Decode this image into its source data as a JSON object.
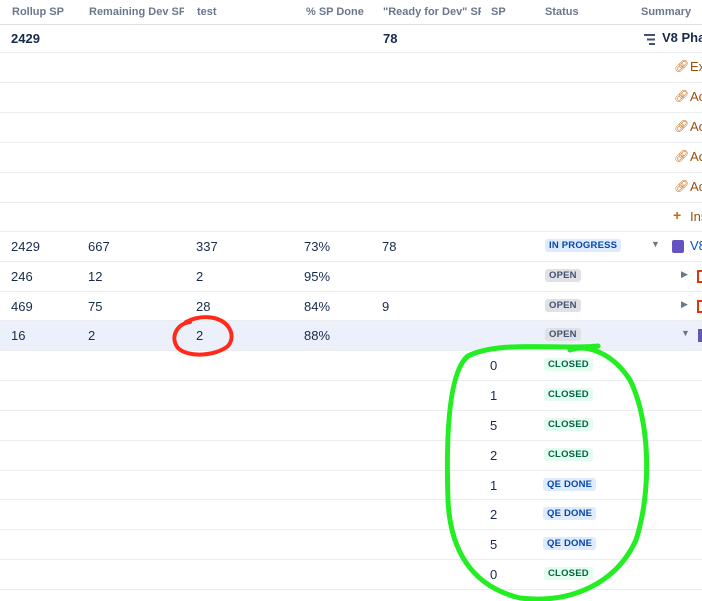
{
  "columns": {
    "rollup_sp": "Rollup SP",
    "remaining_dev_sp": "Remaining Dev SP",
    "test": "test",
    "pct_sp_done": "% SP Done",
    "ready_for_dev": "\"Ready for Dev\" SP",
    "sp": "SP",
    "status": "Status",
    "summary": "Summary"
  },
  "top_row": {
    "rollup_sp": "2429",
    "ready_for_dev": "78",
    "summary": "V8 Pha"
  },
  "link_rows": [
    {
      "label": "Ex"
    },
    {
      "label": "Ac"
    },
    {
      "label": "Ac"
    },
    {
      "label": "Ac"
    },
    {
      "label": "Ac"
    }
  ],
  "insert_row": {
    "label": "Ins"
  },
  "main_rows": [
    {
      "rollup": "2429",
      "remaining": "667",
      "test": "337",
      "pct": "73%",
      "ready": "78",
      "status": "IN PROGRESS",
      "status_type": "inprogress",
      "summary": "V8"
    },
    {
      "rollup": "246",
      "remaining": "12",
      "test": "2",
      "pct": "95%",
      "ready": "",
      "status": "OPEN",
      "status_type": "open",
      "summary": ""
    },
    {
      "rollup": "469",
      "remaining": "75",
      "test": "28",
      "pct": "84%",
      "ready": "9",
      "status": "OPEN",
      "status_type": "open",
      "summary": ""
    },
    {
      "rollup": "16",
      "remaining": "2",
      "test": "2",
      "pct": "88%",
      "ready": "",
      "status": "OPEN",
      "status_type": "open",
      "summary": ""
    }
  ],
  "child_rows": [
    {
      "sp": "0",
      "status": "CLOSED",
      "status_type": "closed"
    },
    {
      "sp": "1",
      "status": "CLOSED",
      "status_type": "closed"
    },
    {
      "sp": "5",
      "status": "CLOSED",
      "status_type": "closed"
    },
    {
      "sp": "2",
      "status": "CLOSED",
      "status_type": "closed"
    },
    {
      "sp": "1",
      "status": "QE DONE",
      "status_type": "qedone"
    },
    {
      "sp": "2",
      "status": "QE DONE",
      "status_type": "qedone"
    },
    {
      "sp": "5",
      "status": "QE DONE",
      "status_type": "qedone"
    },
    {
      "sp": "0",
      "status": "CLOSED",
      "status_type": "closed"
    }
  ],
  "icons": {
    "hierarchy": "hierarchy-icon",
    "link": "link-icon",
    "plus": "plus-icon",
    "epic": "epic-icon",
    "caret": "caret-icon"
  },
  "colors": {
    "annotation_red": "#ff2a1a",
    "annotation_green": "#22ee22",
    "link_orange": "#974f0c",
    "selected_row": "#ebf0fb"
  }
}
